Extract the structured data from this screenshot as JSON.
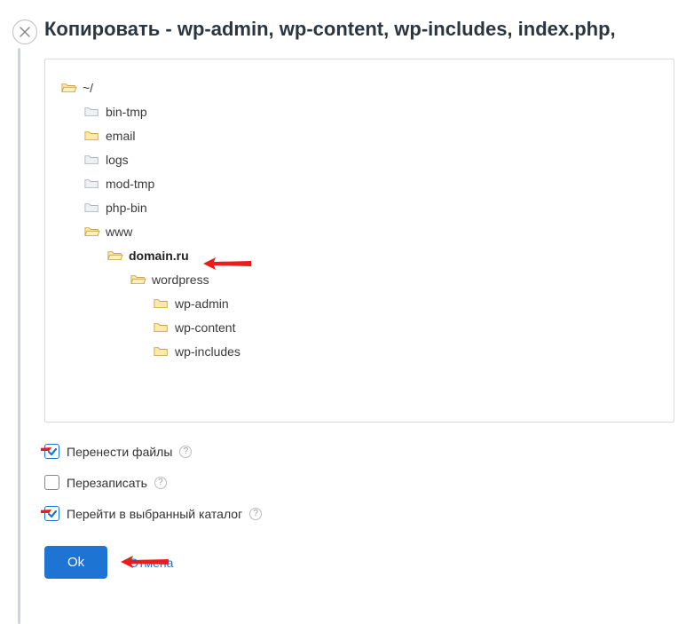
{
  "dialog": {
    "title": "Копировать - wp-admin, wp-content, wp-includes, index.php,"
  },
  "tree": {
    "root": "~/",
    "bin_tmp": "bin-tmp",
    "email": "email",
    "logs": "logs",
    "mod_tmp": "mod-tmp",
    "php_bin": "php-bin",
    "www": "www",
    "domain": "domain.ru",
    "wordpress": "wordpress",
    "wp_admin": "wp-admin",
    "wp_content": "wp-content",
    "wp_includes": "wp-includes"
  },
  "checkboxes": {
    "move_files": {
      "label": "Перенести файлы",
      "checked": true
    },
    "overwrite": {
      "label": "Перезаписать",
      "checked": false
    },
    "go_to_dir": {
      "label": "Перейти в выбранный каталог",
      "checked": true
    }
  },
  "buttons": {
    "ok": "Ok",
    "cancel": "Отмена"
  },
  "help_glyph": "?"
}
